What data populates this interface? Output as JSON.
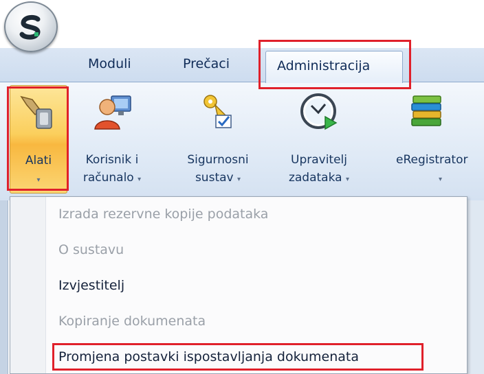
{
  "app": {
    "orb_letter": "S"
  },
  "tabs": [
    {
      "label": "Moduli"
    },
    {
      "label": "Prečaci"
    },
    {
      "label": "Administracija",
      "selected": true
    }
  ],
  "ribbon": {
    "buttons": [
      {
        "line1": "Alati",
        "line2": "",
        "icon": "tools-icon",
        "active": true
      },
      {
        "line1": "Korisnik i",
        "line2": "računalo",
        "icon": "user-computer-icon"
      },
      {
        "line1": "Sigurnosni",
        "line2": "sustav",
        "icon": "security-keys-icon"
      },
      {
        "line1": "Upravitelj",
        "line2": "zadataka",
        "icon": "task-scheduler-icon"
      },
      {
        "line1": "eRegistrator",
        "line2": "",
        "icon": "books-icon"
      }
    ],
    "dropdown_arrow": "▾"
  },
  "menu": {
    "items": [
      {
        "label": "Izrada rezervne kopije podataka",
        "enabled": false
      },
      {
        "label": "O sustavu",
        "enabled": false
      },
      {
        "label": "Izvjestitelj",
        "enabled": true
      },
      {
        "label": "Kopiranje dokumenata",
        "enabled": false
      },
      {
        "label": "Promjena postavki ispostavljanja dokumenata",
        "enabled": true,
        "highlighted": true
      }
    ]
  },
  "colors": {
    "highlight_box": "#e0202a",
    "tab_text": "#0f2b57",
    "disabled_text": "#9aa0a8"
  }
}
